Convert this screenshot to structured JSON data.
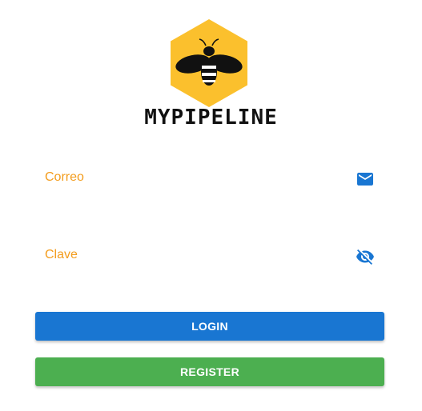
{
  "app": {
    "logo_text": "MYPIPELINE",
    "logo_icon": "bee-hexagon-logo"
  },
  "form": {
    "email": {
      "label": "Correo",
      "value": "",
      "icon": "envelope-icon"
    },
    "password": {
      "label": "Clave",
      "value": "",
      "icon": "eye-off-icon"
    }
  },
  "buttons": {
    "login_label": "LOGIN",
    "register_label": "REGISTER"
  },
  "colors": {
    "label": "#f39c1c",
    "icon": "#1976d2",
    "login": "#1976d2",
    "register": "#4caf50",
    "logo_hex": "#fbc02d"
  }
}
